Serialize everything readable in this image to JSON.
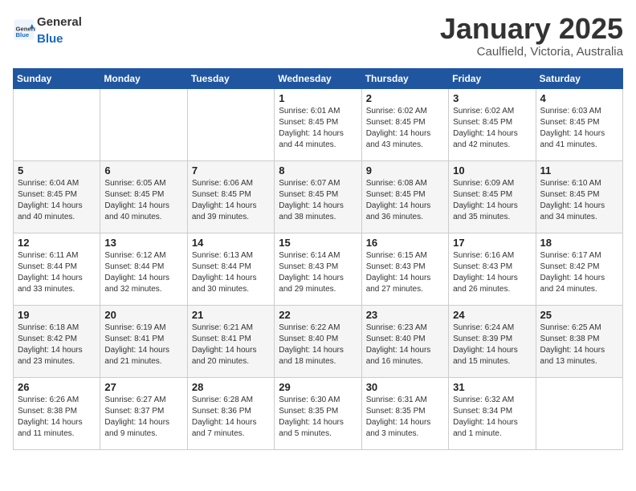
{
  "header": {
    "logo_general": "General",
    "logo_blue": "Blue",
    "month_title": "January 2025",
    "location": "Caulfield, Victoria, Australia"
  },
  "weekdays": [
    "Sunday",
    "Monday",
    "Tuesday",
    "Wednesday",
    "Thursday",
    "Friday",
    "Saturday"
  ],
  "weeks": [
    [
      {
        "day": "",
        "info": ""
      },
      {
        "day": "",
        "info": ""
      },
      {
        "day": "",
        "info": ""
      },
      {
        "day": "1",
        "info": "Sunrise: 6:01 AM\nSunset: 8:45 PM\nDaylight: 14 hours\nand 44 minutes."
      },
      {
        "day": "2",
        "info": "Sunrise: 6:02 AM\nSunset: 8:45 PM\nDaylight: 14 hours\nand 43 minutes."
      },
      {
        "day": "3",
        "info": "Sunrise: 6:02 AM\nSunset: 8:45 PM\nDaylight: 14 hours\nand 42 minutes."
      },
      {
        "day": "4",
        "info": "Sunrise: 6:03 AM\nSunset: 8:45 PM\nDaylight: 14 hours\nand 41 minutes."
      }
    ],
    [
      {
        "day": "5",
        "info": "Sunrise: 6:04 AM\nSunset: 8:45 PM\nDaylight: 14 hours\nand 40 minutes."
      },
      {
        "day": "6",
        "info": "Sunrise: 6:05 AM\nSunset: 8:45 PM\nDaylight: 14 hours\nand 40 minutes."
      },
      {
        "day": "7",
        "info": "Sunrise: 6:06 AM\nSunset: 8:45 PM\nDaylight: 14 hours\nand 39 minutes."
      },
      {
        "day": "8",
        "info": "Sunrise: 6:07 AM\nSunset: 8:45 PM\nDaylight: 14 hours\nand 38 minutes."
      },
      {
        "day": "9",
        "info": "Sunrise: 6:08 AM\nSunset: 8:45 PM\nDaylight: 14 hours\nand 36 minutes."
      },
      {
        "day": "10",
        "info": "Sunrise: 6:09 AM\nSunset: 8:45 PM\nDaylight: 14 hours\nand 35 minutes."
      },
      {
        "day": "11",
        "info": "Sunrise: 6:10 AM\nSunset: 8:45 PM\nDaylight: 14 hours\nand 34 minutes."
      }
    ],
    [
      {
        "day": "12",
        "info": "Sunrise: 6:11 AM\nSunset: 8:44 PM\nDaylight: 14 hours\nand 33 minutes."
      },
      {
        "day": "13",
        "info": "Sunrise: 6:12 AM\nSunset: 8:44 PM\nDaylight: 14 hours\nand 32 minutes."
      },
      {
        "day": "14",
        "info": "Sunrise: 6:13 AM\nSunset: 8:44 PM\nDaylight: 14 hours\nand 30 minutes."
      },
      {
        "day": "15",
        "info": "Sunrise: 6:14 AM\nSunset: 8:43 PM\nDaylight: 14 hours\nand 29 minutes."
      },
      {
        "day": "16",
        "info": "Sunrise: 6:15 AM\nSunset: 8:43 PM\nDaylight: 14 hours\nand 27 minutes."
      },
      {
        "day": "17",
        "info": "Sunrise: 6:16 AM\nSunset: 8:43 PM\nDaylight: 14 hours\nand 26 minutes."
      },
      {
        "day": "18",
        "info": "Sunrise: 6:17 AM\nSunset: 8:42 PM\nDaylight: 14 hours\nand 24 minutes."
      }
    ],
    [
      {
        "day": "19",
        "info": "Sunrise: 6:18 AM\nSunset: 8:42 PM\nDaylight: 14 hours\nand 23 minutes."
      },
      {
        "day": "20",
        "info": "Sunrise: 6:19 AM\nSunset: 8:41 PM\nDaylight: 14 hours\nand 21 minutes."
      },
      {
        "day": "21",
        "info": "Sunrise: 6:21 AM\nSunset: 8:41 PM\nDaylight: 14 hours\nand 20 minutes."
      },
      {
        "day": "22",
        "info": "Sunrise: 6:22 AM\nSunset: 8:40 PM\nDaylight: 14 hours\nand 18 minutes."
      },
      {
        "day": "23",
        "info": "Sunrise: 6:23 AM\nSunset: 8:40 PM\nDaylight: 14 hours\nand 16 minutes."
      },
      {
        "day": "24",
        "info": "Sunrise: 6:24 AM\nSunset: 8:39 PM\nDaylight: 14 hours\nand 15 minutes."
      },
      {
        "day": "25",
        "info": "Sunrise: 6:25 AM\nSunset: 8:38 PM\nDaylight: 14 hours\nand 13 minutes."
      }
    ],
    [
      {
        "day": "26",
        "info": "Sunrise: 6:26 AM\nSunset: 8:38 PM\nDaylight: 14 hours\nand 11 minutes."
      },
      {
        "day": "27",
        "info": "Sunrise: 6:27 AM\nSunset: 8:37 PM\nDaylight: 14 hours\nand 9 minutes."
      },
      {
        "day": "28",
        "info": "Sunrise: 6:28 AM\nSunset: 8:36 PM\nDaylight: 14 hours\nand 7 minutes."
      },
      {
        "day": "29",
        "info": "Sunrise: 6:30 AM\nSunset: 8:35 PM\nDaylight: 14 hours\nand 5 minutes."
      },
      {
        "day": "30",
        "info": "Sunrise: 6:31 AM\nSunset: 8:35 PM\nDaylight: 14 hours\nand 3 minutes."
      },
      {
        "day": "31",
        "info": "Sunrise: 6:32 AM\nSunset: 8:34 PM\nDaylight: 14 hours\nand 1 minute."
      },
      {
        "day": "",
        "info": ""
      }
    ]
  ]
}
